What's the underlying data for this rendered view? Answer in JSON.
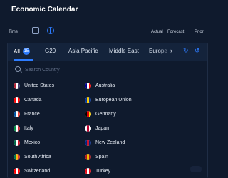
{
  "header": {
    "title": "Economic Calendar",
    "time_label": "Time",
    "actual_label": "Actual",
    "forecast_label": "Forecast",
    "prior_label": "Prior"
  },
  "tabs": {
    "all_label": "All",
    "all_badge": "15",
    "g20_label": "G20",
    "asia_pacific_label": "Asia Pacific",
    "middle_east_label": "Middle East",
    "europe_label": "Europe",
    "next_glyph": "›",
    "refresh_glyph": "↻",
    "reset_glyph": "↺"
  },
  "search": {
    "placeholder": "Search Country"
  },
  "countries": [
    {
      "name": "United States",
      "flag_colors": [
        "#b22234",
        "#ffffff",
        "#3c3b6e"
      ]
    },
    {
      "name": "Australia",
      "flag_colors": [
        "#00008b",
        "#ffffff",
        "#ff0000"
      ]
    },
    {
      "name": "Canada",
      "flag_colors": [
        "#ff0000",
        "#ffffff",
        "#ff0000"
      ]
    },
    {
      "name": "European Union",
      "flag_colors": [
        "#003399",
        "#ffcc00",
        "#003399"
      ]
    },
    {
      "name": "France",
      "flag_colors": [
        "#0055a4",
        "#ffffff",
        "#ef4135"
      ]
    },
    {
      "name": "Germany",
      "flag_colors": [
        "#000000",
        "#dd0000",
        "#ffce00"
      ]
    },
    {
      "name": "Italy",
      "flag_colors": [
        "#009246",
        "#ffffff",
        "#ce2b37"
      ]
    },
    {
      "name": "Japan",
      "flag_colors": [
        "#ffffff",
        "#bc002d",
        "#ffffff"
      ]
    },
    {
      "name": "Mexico",
      "flag_colors": [
        "#006847",
        "#ffffff",
        "#ce1126"
      ]
    },
    {
      "name": "New Zealand",
      "flag_colors": [
        "#00247d",
        "#cc142b",
        "#00247d"
      ]
    },
    {
      "name": "South Africa",
      "flag_colors": [
        "#007a4d",
        "#ffb612",
        "#de3831"
      ]
    },
    {
      "name": "Spain",
      "flag_colors": [
        "#aa151b",
        "#f1bf00",
        "#aa151b"
      ]
    },
    {
      "name": "Switzerland",
      "flag_colors": [
        "#ff0000",
        "#ffffff",
        "#ff0000"
      ]
    },
    {
      "name": "Turkey",
      "flag_colors": [
        "#e30a17",
        "#ffffff",
        "#e30a17"
      ]
    }
  ],
  "accent_color": "#2d7cff"
}
